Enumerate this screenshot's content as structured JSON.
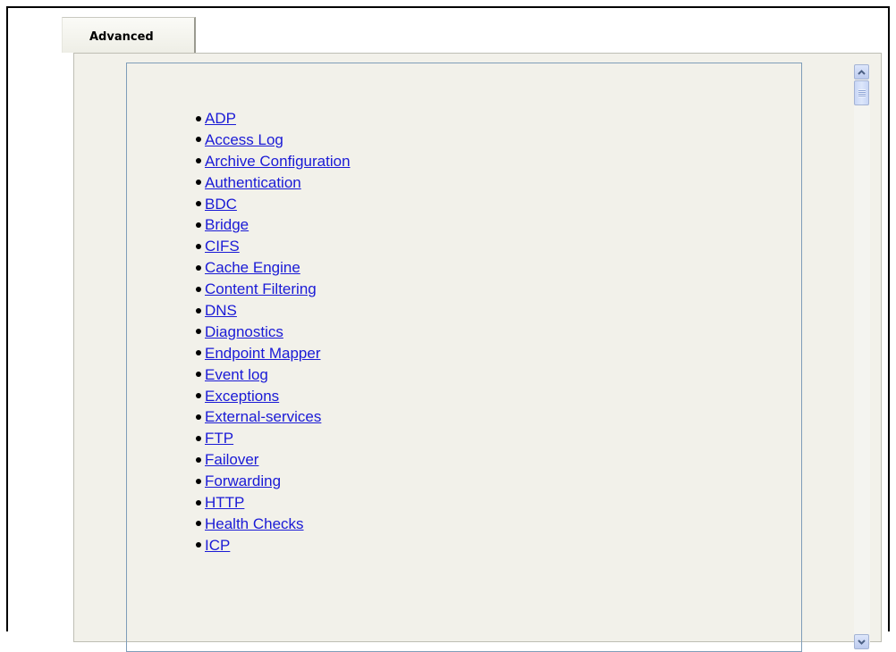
{
  "tabs": [
    {
      "label": "Advanced",
      "active": true
    }
  ],
  "link_list": {
    "items": [
      "ADP",
      "Access Log",
      "Archive Configuration",
      "Authentication",
      "BDC",
      "Bridge",
      "CIFS",
      "Cache Engine",
      "Content Filtering",
      "DNS",
      "Diagnostics",
      "Endpoint Mapper",
      "Event log",
      "Exceptions",
      "External-services",
      "FTP",
      "Failover",
      "Forwarding",
      "HTTP",
      "Health Checks",
      "ICP"
    ]
  },
  "scrollbar": {
    "up_icon": "scroll-up-arrow-icon",
    "down_icon": "scroll-down-arrow-icon"
  },
  "colors": {
    "link": "#1a1ad6",
    "panel_background": "#f2f1ea",
    "content_border": "#7f9db9"
  }
}
